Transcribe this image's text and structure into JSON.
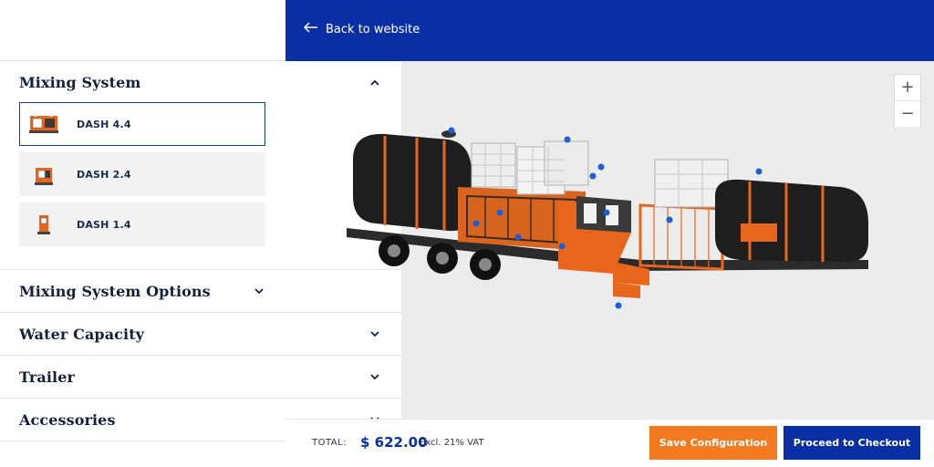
{
  "header": {
    "back_label": "Back to website"
  },
  "sidebar": {
    "sections": [
      {
        "title": "Mixing System",
        "expanded": true,
        "options": [
          {
            "label": "DASH 4.4",
            "selected": true
          },
          {
            "label": "DASH 2.4",
            "selected": false
          },
          {
            "label": "DASH 1.4",
            "selected": false
          }
        ]
      },
      {
        "title": "Mixing System Options",
        "expanded": false
      },
      {
        "title": "Water Capacity",
        "expanded": false
      },
      {
        "title": "Trailer",
        "expanded": false
      },
      {
        "title": "Accessories",
        "expanded": false
      }
    ]
  },
  "viewer": {
    "zoom_in": "+",
    "zoom_out": "−"
  },
  "footer": {
    "total_label": "TOTAL:",
    "total_price": "$ 622.00",
    "vat_note": "Excl. 21% VAT",
    "save_label": "Save Configuration",
    "checkout_label": "Proceed to Checkout"
  },
  "colors": {
    "brand_blue": "#0a2fa4",
    "accent_orange": "#f47a20",
    "selected_border": "#1b3f8f",
    "viewer_bg": "#ececec"
  },
  "icons": {
    "back": "arrow-left-icon",
    "expanded": "chevron-up-icon",
    "collapsed": "chevron-down-icon"
  }
}
